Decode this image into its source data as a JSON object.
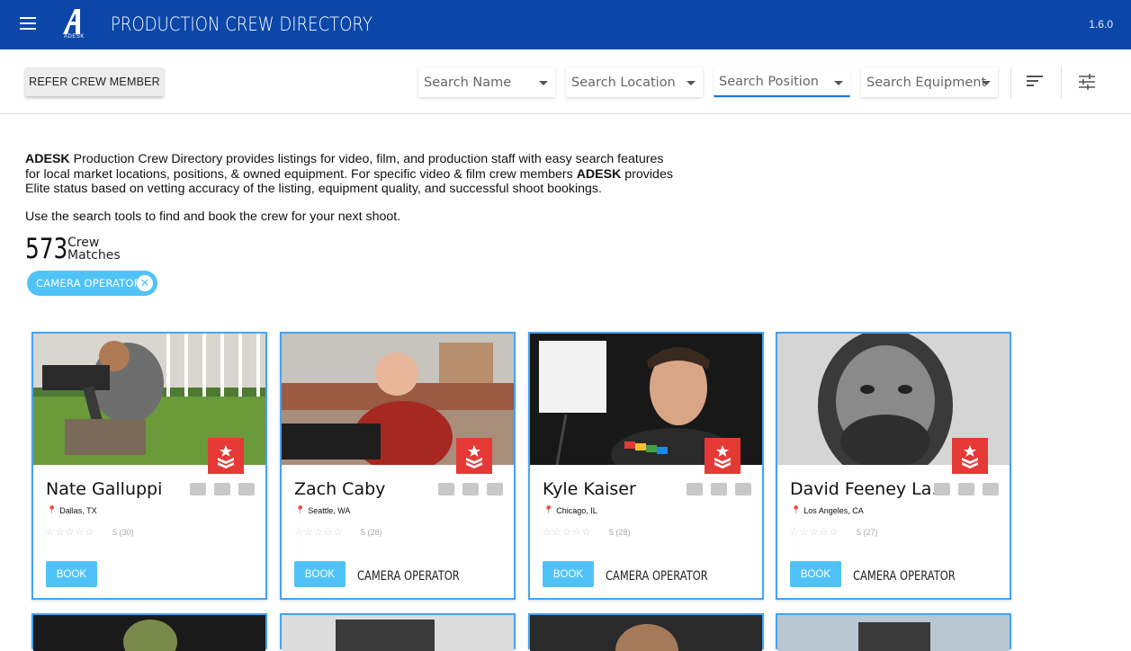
{
  "header": {
    "title": "PRODUCTION CREW DIRECTORY",
    "logo_sub": "ADESK",
    "version": "1.6.0"
  },
  "toolbar": {
    "refer_label": "REFER CREW MEMBER",
    "filters": {
      "name": "Search Name",
      "location": "Search Location",
      "position": "Search Position",
      "equipment": "Search Equipment"
    }
  },
  "intro": {
    "brand": "ADESK",
    "line1": " Production Crew Directory provides listings for video, film, and production staff with easy search features for local market locations, positions, & owned equipment. For specific video & film crew members ",
    "line2": " provides Elite status based on vetting accuracy of the listing, equipment quality, and successful shoot bookings.",
    "cta": "Use the search tools to find and book the crew for your next shoot."
  },
  "matches": {
    "count": "573",
    "label_1": "Crew",
    "label_2": "Matches"
  },
  "active_filter": "CAMERA OPERATOR",
  "cards": [
    {
      "name": "Nate Galluppi",
      "location": "Dallas, TX",
      "rating": "5 (30)",
      "book": "BOOK",
      "position": ""
    },
    {
      "name": "Zach Caby",
      "location": "Seattle, WA",
      "rating": "5 (28)",
      "book": "BOOK",
      "position": "CAMERA OPERATOR"
    },
    {
      "name": "Kyle Kaiser",
      "location": "Chicago, IL",
      "rating": "5 (28)",
      "book": "BOOK",
      "position": "CAMERA OPERATOR"
    },
    {
      "name": "David Feeney La...",
      "location": "Los Angeles, CA",
      "rating": "5 (27)",
      "book": "BOOK",
      "position": "CAMERA OPERATOR"
    }
  ],
  "stars": "☆☆☆☆☆",
  "colors": {
    "appbar": "#0b47a8",
    "accent": "#4fc3f7",
    "card_border": "#42a5f5",
    "elite": "#e53935"
  }
}
